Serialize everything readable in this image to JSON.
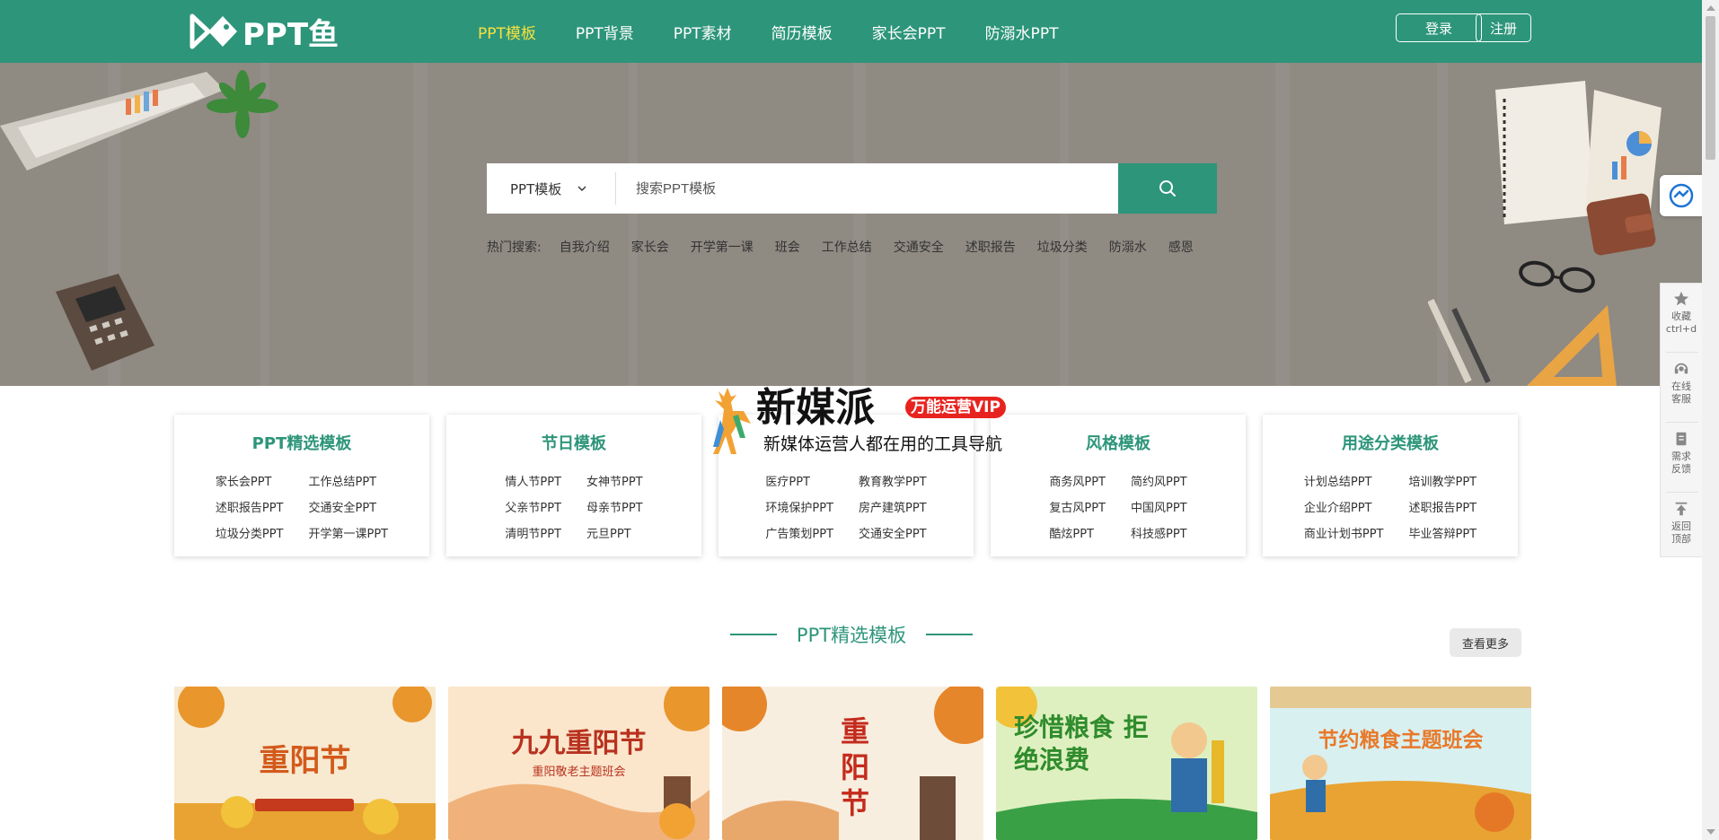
{
  "header": {
    "logo_text": "PPT鱼",
    "nav": [
      {
        "label": "PPT模板",
        "active": true
      },
      {
        "label": "PPT背景",
        "active": false
      },
      {
        "label": "PPT素材",
        "active": false
      },
      {
        "label": "简历模板",
        "active": false
      },
      {
        "label": "家长会PPT",
        "active": false
      },
      {
        "label": "防溺水PPT",
        "active": false
      }
    ],
    "login_label": "登录",
    "register_label": "注册",
    "brand_color": "#2d957a",
    "active_color": "#f8e13e"
  },
  "search": {
    "category": "PPT模板",
    "placeholder": "搜索PPT模板",
    "hot_label": "热门搜索:",
    "hot_terms": [
      "自我介绍",
      "家长会",
      "开学第一课",
      "班会",
      "工作总结",
      "交通安全",
      "述职报告",
      "垃圾分类",
      "防溺水",
      "感恩"
    ]
  },
  "categories": [
    {
      "title": "PPT精选模板",
      "links": [
        "家长会PPT",
        "工作总结PPT",
        "述职报告PPT",
        "交通安全PPT",
        "垃圾分类PPT",
        "开学第一课PPT"
      ]
    },
    {
      "title": "节日模板",
      "links": [
        "情人节PPT",
        "女神节PPT",
        "父亲节PPT",
        "母亲节PPT",
        "清明节PPT",
        "元旦PPT"
      ]
    },
    {
      "title": "",
      "links": [
        "医疗PPT",
        "教育教学PPT",
        "环境保护PPT",
        "房产建筑PPT",
        "广告策划PPT",
        "交通安全PPT"
      ]
    },
    {
      "title": "风格模板",
      "links": [
        "商务风PPT",
        "简约风PPT",
        "复古风PPT",
        "中国风PPT",
        "酷炫PPT",
        "科技感PPT"
      ]
    },
    {
      "title": "用途分类模板",
      "links": [
        "计划总结PPT",
        "培训教学PPT",
        "企业介绍PPT",
        "述职报告PPT",
        "商业计划书PPT",
        "毕业答辩PPT"
      ]
    }
  ],
  "watermark": {
    "title": "新媒派",
    "badge": "万能运营VIP",
    "subtitle": "新媒体运营人都在用的工具导航"
  },
  "section": {
    "title": "PPT精选模板",
    "more_label": "查看更多"
  },
  "thumbnails": [
    {
      "title": "重阳节",
      "bg": "#f6e7c5",
      "accent": "#e5892a"
    },
    {
      "title": "九九重阳节",
      "subtitle": "重阳敬老主题班会",
      "bg": "#fbe7cf",
      "accent": "#b8321f"
    },
    {
      "title": "重阳节",
      "bg": "#f8eee0",
      "accent": "#c42b1c"
    },
    {
      "title": "珍惜粮食 拒绝浪费",
      "bg": "#dfeeb9",
      "accent": "#2f8c2c"
    },
    {
      "title": "节约粮食主题班会",
      "bg": "#d9f0f1",
      "accent": "#e8792a"
    }
  ],
  "sidebar": {
    "items": [
      {
        "label": "收藏",
        "sub": "ctrl+d"
      },
      {
        "label": "在线",
        "sub": "客服"
      },
      {
        "label": "需求",
        "sub": "反馈"
      },
      {
        "label": "返回",
        "sub": "顶部"
      }
    ]
  }
}
